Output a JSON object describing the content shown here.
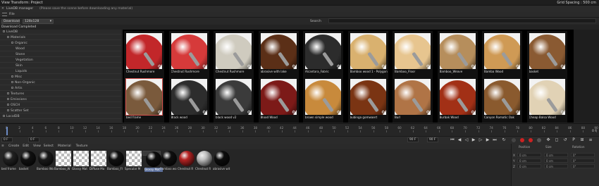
{
  "titlebar": {
    "title": "View Transform: Project",
    "right": "Grid Spacing : 500 cm"
  },
  "manager": {
    "title": "LiveDB manager",
    "notice": "(Please save the scene before downloading any material)"
  },
  "menu": {
    "file": "File"
  },
  "download": {
    "mode": "Download",
    "resolution": "128x128",
    "search_label": "Search",
    "status": "Download Completed"
  },
  "tree": [
    {
      "label": "LiveDB",
      "indent": 0
    },
    {
      "label": "Materials",
      "indent": 1
    },
    {
      "label": "Organic",
      "indent": 2
    },
    {
      "label": "Wood",
      "indent": 3
    },
    {
      "label": "Stone",
      "indent": 3
    },
    {
      "label": "Vegetation",
      "indent": 3
    },
    {
      "label": "Skin",
      "indent": 3
    },
    {
      "label": "Liquids",
      "indent": 3
    },
    {
      "label": "Misc",
      "indent": 2
    },
    {
      "label": "Non-Organic",
      "indent": 2
    },
    {
      "label": "Artis",
      "indent": 2
    },
    {
      "label": "Textures",
      "indent": 1
    },
    {
      "label": "Emissions",
      "indent": 1
    },
    {
      "label": "OSCH",
      "indent": 1
    },
    {
      "label": "Scatter Set",
      "indent": 1
    },
    {
      "label": "LocalDB",
      "indent": 0
    }
  ],
  "materials_row1": [
    {
      "name": "Chestnut Rushmore",
      "color": "#c2272a",
      "icon": "gear-icon"
    },
    {
      "name": "Chestnut Rushmore",
      "color": "#d63a3a",
      "icon": "gear-icon"
    },
    {
      "name": "Chestnut Rushmore",
      "color": "#cfcbbf",
      "icon": "gear-icon"
    },
    {
      "name": "abrasive with lake",
      "color": "#5b2f17",
      "icon": "gear-icon"
    },
    {
      "name": "Alcantara_Fabric",
      "color": "#2c2c2c",
      "icon": "gear-icon"
    },
    {
      "name": "Bamboo wood 1 - Polygon",
      "color": "#d9b16f",
      "icon": "gear-icon"
    },
    {
      "name": "Bamboo_Floor",
      "color": "#e7c58f",
      "icon": "gear-icon"
    },
    {
      "name": "Bamboo_Weave",
      "color": "#b68e5c",
      "icon": "gear-icon"
    },
    {
      "name": "Bamba Wood",
      "color": "#cf9a55",
      "icon": "gear-icon"
    },
    {
      "name": "basket",
      "color": "#8a5a32",
      "icon": "gear-icon"
    }
  ],
  "materials_row2": [
    {
      "name": "bed frame",
      "color": "#7a5a3c",
      "icon": "gear-icon"
    },
    {
      "name": "Black wood",
      "color": "#2d2d2d",
      "icon": "gear-icon"
    },
    {
      "name": "black wood v2",
      "color": "#3b3b3b",
      "icon": "gear-icon"
    },
    {
      "name": "Blood Wood",
      "color": "#7c1a18",
      "icon": "gear-icon"
    },
    {
      "name": "brown simple wood",
      "color": "#c88a3c",
      "icon": "gear-icon"
    },
    {
      "name": "bubinga gomwaert",
      "color": "#7a3413",
      "icon": "gear-icon"
    },
    {
      "name": "Burl",
      "color": "#b07446",
      "icon": "gear-icon"
    },
    {
      "name": "Burbak Wood",
      "color": "#a23016",
      "icon": "gear-icon"
    },
    {
      "name": "Canyon Romatic Oak",
      "color": "#8a5a2e",
      "icon": "gear-icon"
    },
    {
      "name": "Cheap Balsa Wood",
      "color": "#e1d2b5",
      "icon": "gear-icon"
    }
  ],
  "timeline": {
    "ticks": [
      "0",
      "2",
      "4",
      "6",
      "8",
      "10",
      "12",
      "14",
      "16",
      "18",
      "20",
      "22",
      "24",
      "26",
      "28",
      "30",
      "32",
      "34",
      "36",
      "38",
      "40",
      "42",
      "44",
      "46",
      "48",
      "50",
      "52",
      "54",
      "56",
      "58",
      "60",
      "62",
      "64",
      "66",
      "68",
      "70",
      "72",
      "74",
      "76",
      "78",
      "80",
      "82",
      "84",
      "86",
      "88",
      "90"
    ],
    "current_frame": "0 F",
    "end_frame": "90 F",
    "field_a": "0 F",
    "field_b": "0 F",
    "field_c": "90 F",
    "field_d": "90 F"
  },
  "matbar": [
    "Create",
    "Edit",
    "View",
    "Select",
    "Material",
    "Texture"
  ],
  "mats": [
    {
      "name": "bed frame",
      "color": "#222"
    },
    {
      "name": "basket",
      "color": "#111"
    },
    {
      "name": "Bamboo Wo",
      "color": "#1a1a1a"
    },
    {
      "name": "Bamboo_W",
      "color": "checker"
    },
    {
      "name": "Glossy Mat",
      "color": "checker"
    },
    {
      "name": "Diffuse Ma",
      "color": "checker"
    },
    {
      "name": "Bamboo_Fl",
      "color": "#111"
    },
    {
      "name": "Specular M",
      "color": "checker"
    },
    {
      "name": "Glossy Mat",
      "color": "#0d0d0d"
    },
    {
      "name": "Bamboo wo",
      "color": "#0f0f0f"
    },
    {
      "name": "Chestnut R",
      "color": "#b62323"
    },
    {
      "name": "Chestnut R",
      "color": "#bfbfbf"
    },
    {
      "name": "abrasive wit",
      "color": "#0d0d0d"
    }
  ],
  "coords": {
    "headers": [
      "Position",
      "Size",
      "Rotation"
    ],
    "rows": [
      {
        "axis": "X",
        "p": "0 cm",
        "s": "0 cm",
        "r": "0°"
      },
      {
        "axis": "Y",
        "p": "0 cm",
        "s": "0 cm",
        "r": "0°"
      },
      {
        "axis": "Z",
        "p": "0 cm",
        "s": "0 cm",
        "r": "0°"
      }
    ],
    "mode": "Object (Rel)",
    "size_mode": "Size",
    "apply": "Apply"
  }
}
